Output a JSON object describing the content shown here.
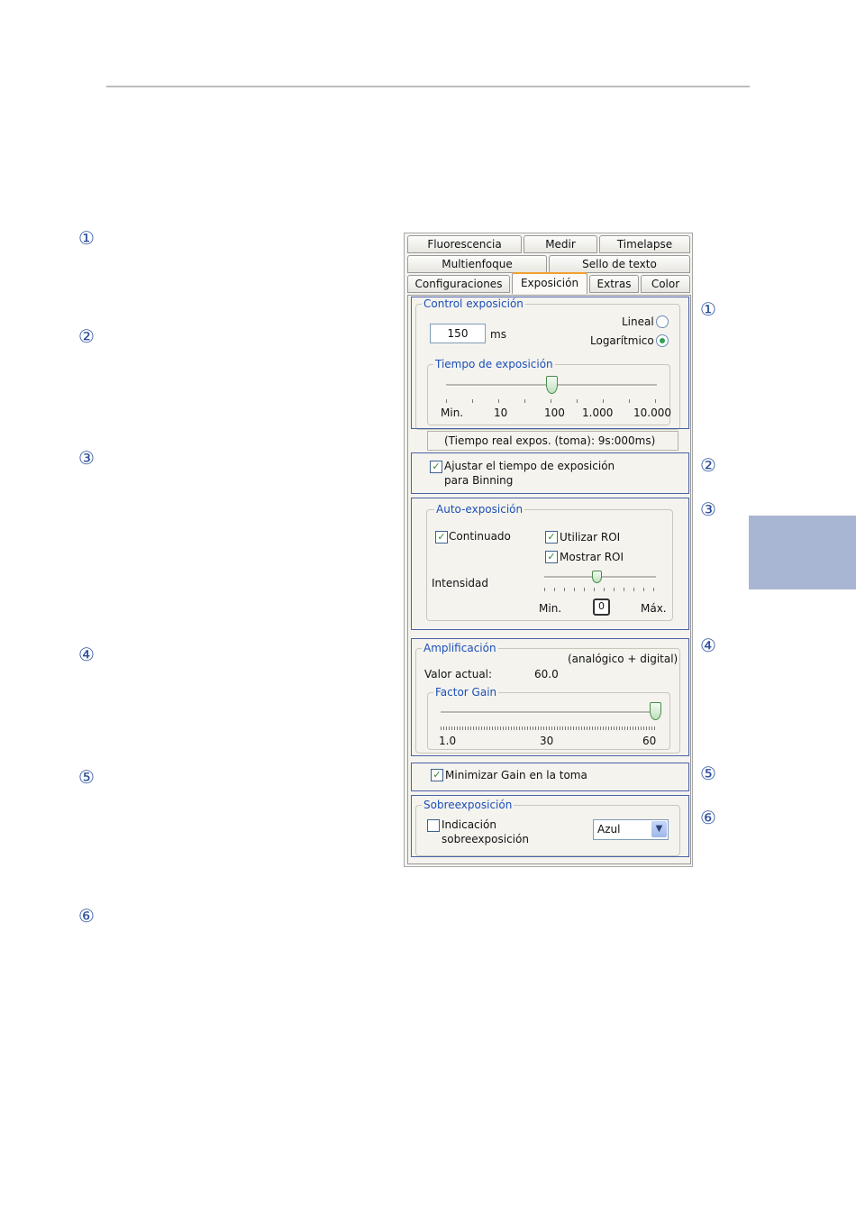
{
  "callouts": {
    "left": [
      "①",
      "②",
      "③",
      "④",
      "⑤",
      "⑥"
    ],
    "right": [
      "①",
      "②",
      "③",
      "④",
      "⑤",
      "⑥"
    ]
  },
  "tabs": {
    "row1": [
      "Fluorescencia",
      "Medir",
      "Timelapse"
    ],
    "row2": [
      "Multienfoque",
      "Sello de texto"
    ],
    "row3": [
      "Configuraciones",
      "Exposición",
      "Extras",
      "Color"
    ]
  },
  "exposure_control": {
    "legend": "Control exposición",
    "value": "150",
    "unit": "ms",
    "mode_linear": "Lineal",
    "mode_log": "Logarítmico",
    "mode_selected": "Logarítmico",
    "time_legend": "Tiempo de exposición",
    "slider_labels": [
      "Min.",
      "10",
      "100",
      "1.000",
      "10.000"
    ],
    "slider_value_label": "100"
  },
  "real_exposure": "(Tiempo real expos. (toma): 9s:000ms)",
  "binning": {
    "label_line1": "Ajustar el tiempo de exposición",
    "label_line2": "para Binning",
    "checked": true
  },
  "auto_exposure": {
    "legend": "Auto-exposición",
    "continuous": "Continuado",
    "use_roi": "Utilizar ROI",
    "show_roi": "Mostrar ROI",
    "intensity": "Intensidad",
    "min": "Min.",
    "max": "Máx.",
    "value": "0"
  },
  "amplification": {
    "legend": "Amplificación",
    "mode": "(analógico + digital)",
    "current_label": "Valor actual:",
    "current_value": "60.0",
    "gain_legend": "Factor Gain",
    "slider_labels": [
      "1.0",
      "30",
      "60"
    ],
    "slider_value_label": "60"
  },
  "minimize_gain": {
    "label": "Minimizar Gain en la toma",
    "checked": true
  },
  "overexposure": {
    "legend": "Sobreexposición",
    "label_line1": "Indicación",
    "label_line2": "sobreexposición",
    "checked": false,
    "color_selected": "Azul"
  },
  "colors": {
    "accent_blue": "#1c4fb8",
    "callout_blue": "#2b4e9b",
    "side_tab": "#a9b6d3",
    "active_tab_border": "#f0a030"
  }
}
